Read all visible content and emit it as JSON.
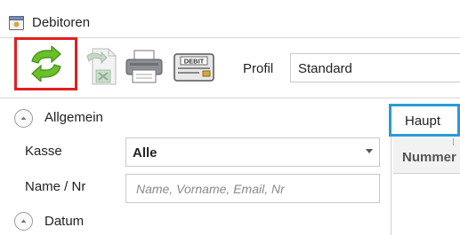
{
  "window": {
    "title": "Debitoren",
    "icon": "app-window-icon"
  },
  "toolbar": {
    "buttons": [
      {
        "name": "refresh",
        "icon": "refresh-arrows-icon",
        "highlighted": true,
        "highlight_color": "#e02020"
      },
      {
        "name": "export",
        "icon": "excel-export-icon",
        "enabled": false
      },
      {
        "name": "print",
        "icon": "printer-icon"
      },
      {
        "name": "debit-card",
        "icon": "debit-card-icon",
        "card_text": "DEBIT"
      }
    ],
    "profile_label": "Profil",
    "profile_value": "Standard"
  },
  "filter_panel": {
    "sections": {
      "general": {
        "label": "Allgemein",
        "expanded": true
      },
      "date": {
        "label": "Datum",
        "expanded": true
      }
    },
    "fields": {
      "kasse": {
        "label": "Kasse",
        "value": "Alle"
      },
      "name_nr": {
        "label": "Name / Nr",
        "value": "",
        "placeholder": "Name, Vorname, Email, Nr"
      }
    }
  },
  "main_panel": {
    "tabs": [
      {
        "label": "Haupt",
        "highlighted": true,
        "highlight_color": "#2a9bd5"
      }
    ],
    "columns": [
      {
        "label": "Nummer"
      }
    ]
  }
}
